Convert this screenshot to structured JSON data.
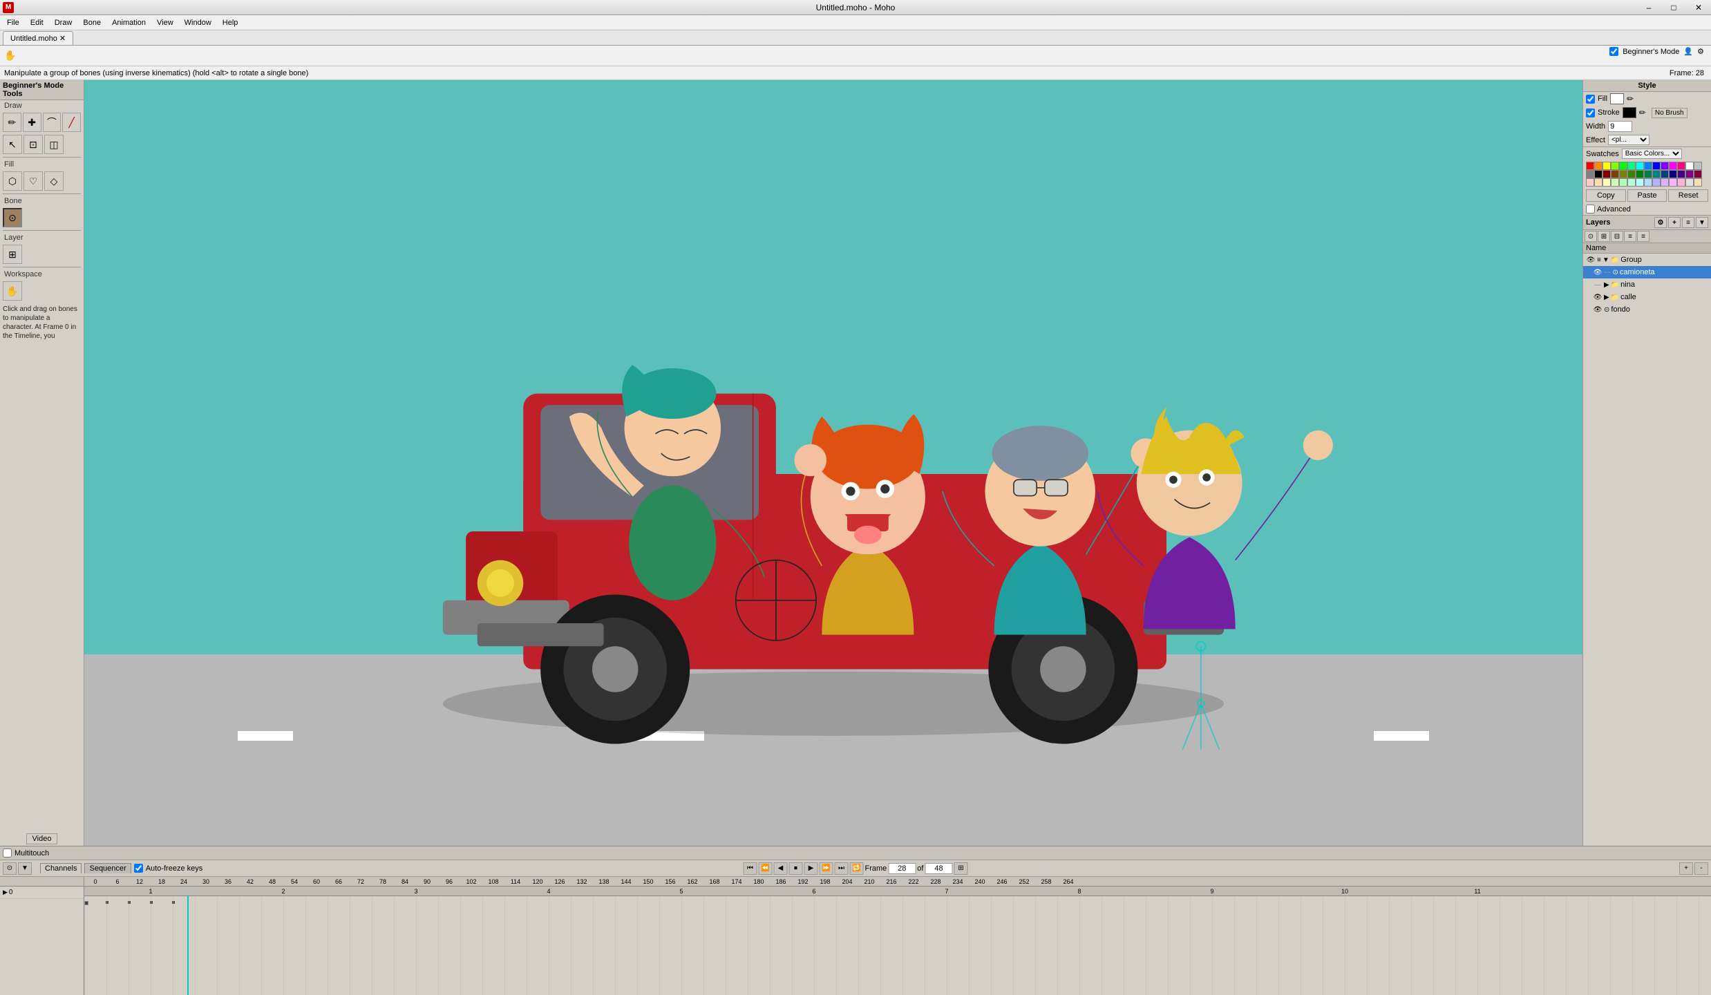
{
  "window": {
    "title": "Untitled.moho - Moho",
    "tab": "Untitled.moho",
    "frame_number": "28",
    "total_frames": "48"
  },
  "menu": {
    "items": [
      "File",
      "Edit",
      "Draw",
      "Bone",
      "Animation",
      "View",
      "Window",
      "Help"
    ]
  },
  "toolbar": {
    "hand_tool": "✋"
  },
  "status": {
    "message": "Manipulate a group of bones (using inverse kinematics) (hold <alt> to rotate a single bone)",
    "beginner_mode_label": "Beginner's Mode",
    "frame_label": "Frame: 28"
  },
  "tool_panel": {
    "header": "Beginner's Mode Tools",
    "sections": {
      "draw": "Draw",
      "fill": "Fill",
      "bone": "Bone",
      "layer": "Layer",
      "workspace": "Workspace"
    }
  },
  "style_panel": {
    "header": "Style",
    "fill_label": "Fill",
    "stroke_label": "Stroke",
    "width_label": "Width",
    "width_value": "9",
    "effect_label": "Effect",
    "effect_value": "<pl...",
    "no_brush": "No Brush",
    "swatches_label": "Swatches",
    "swatches_preset": "Basic Colors...",
    "copy_btn": "Copy",
    "paste_btn": "Paste",
    "reset_btn": "Reset",
    "advanced_label": "Advanced"
  },
  "layers_panel": {
    "header": "Layers",
    "name_col": "Name",
    "items": [
      {
        "id": "group",
        "label": "Group",
        "indent": 0,
        "type": "group",
        "expanded": true,
        "selected": false
      },
      {
        "id": "camioneta",
        "label": "camioneta",
        "indent": 1,
        "type": "bones",
        "selected": true
      },
      {
        "id": "nina",
        "label": "nina",
        "indent": 1,
        "type": "group",
        "selected": false
      },
      {
        "id": "calle",
        "label": "calle",
        "indent": 1,
        "type": "group",
        "selected": false
      },
      {
        "id": "fondo",
        "label": "fondo",
        "indent": 1,
        "type": "circle",
        "selected": false
      }
    ]
  },
  "timeline": {
    "channels_tab": "Channels",
    "sequencer_tab": "Sequencer",
    "auto_freeze_label": "Auto-freeze keys",
    "frame_label": "Frame",
    "of_label": "of",
    "frame_value": "28",
    "total_value": "48",
    "ruler_marks": [
      "0",
      "6",
      "12",
      "18",
      "24",
      "30",
      "36",
      "42",
      "48",
      "54",
      "60",
      "66",
      "72",
      "78",
      "84",
      "90",
      "96",
      "102",
      "108",
      "114",
      "120",
      "126",
      "132",
      "138",
      "144",
      "150",
      "156",
      "162",
      "168",
      "174",
      "180",
      "186",
      "192",
      "198",
      "204",
      "210",
      "216",
      "222",
      "228",
      "234",
      "240",
      "246",
      "252",
      "258",
      "264"
    ],
    "number_marks": [
      "1",
      "2",
      "3",
      "4",
      "5",
      "6",
      "7",
      "8",
      "9",
      "10",
      "11"
    ]
  },
  "multitouch": {
    "label": "Multitouch"
  }
}
